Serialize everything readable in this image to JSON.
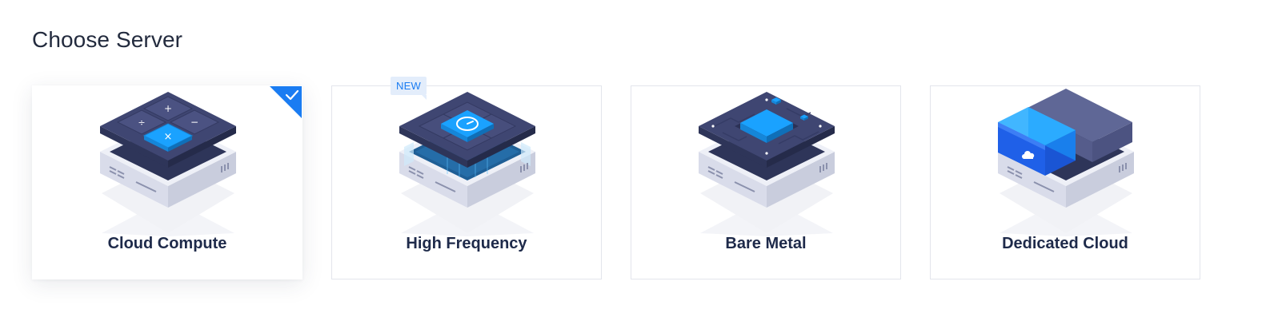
{
  "page": {
    "title": "Choose Server"
  },
  "server_options": [
    {
      "label": "Cloud Compute",
      "selected": true,
      "icon": "calculator-chip-server-icon"
    },
    {
      "label": "High Frequency",
      "selected": false,
      "badge": "NEW",
      "icon": "speedometer-chip-server-icon"
    },
    {
      "label": "Bare Metal",
      "selected": false,
      "icon": "motherboard-server-icon"
    },
    {
      "label": "Dedicated Cloud",
      "selected": false,
      "icon": "cloud-blade-server-icon"
    }
  ],
  "colors": {
    "accent": "#1a7cf2",
    "title_text": "#232b3e",
    "label_text": "#1e2a4a",
    "card_border": "#e3e5ec",
    "badge_bg": "#e3edfb",
    "chip_dark": "#3a4168",
    "chip_blue": "#1aa2ff",
    "base_light": "#dfe2ee"
  }
}
